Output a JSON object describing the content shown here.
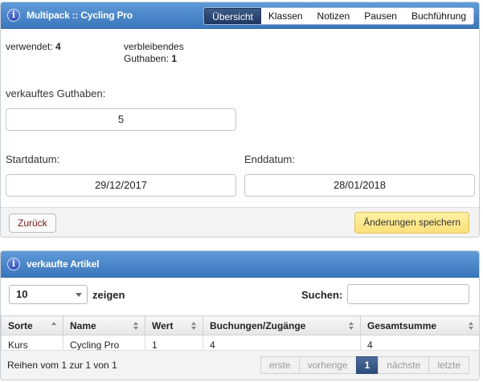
{
  "multipack": {
    "title": "Multipack :: Cycling Pro",
    "tabs": [
      "Übersicht",
      "Klassen",
      "Notizen",
      "Pausen",
      "Buchführung"
    ],
    "used_label": "verwendet:",
    "used_value": "4",
    "remaining_label_line1": "verbleibendes",
    "remaining_label_line2": "Guthaben:",
    "remaining_value": "1",
    "sold_label": "verkauftes Guthaben:",
    "sold_value": "5",
    "start_label": "Startdatum:",
    "start_value": "29/12/2017",
    "end_label": "Enddatum:",
    "end_value": "28/01/2018",
    "back_button": "Zurück",
    "save_button": "Änderungen speichern"
  },
  "sold_items": {
    "title": "verkaufte Artikel",
    "page_size": "10",
    "show_label": "zeigen",
    "search_label": "Suchen:",
    "search_value": "",
    "columns": [
      "Sorte",
      "Name",
      "Wert",
      "Buchungen/Zugänge",
      "Gesamtsumme"
    ],
    "rows": [
      [
        "Kurs",
        "Cycling Pro",
        "1",
        "4",
        "4"
      ]
    ],
    "info": "Reihen vom 1 zur 1 von 1",
    "pager": {
      "first": "erste",
      "prev": "vorherige",
      "current": "1",
      "next": "nächste",
      "last": "letzte"
    }
  }
}
